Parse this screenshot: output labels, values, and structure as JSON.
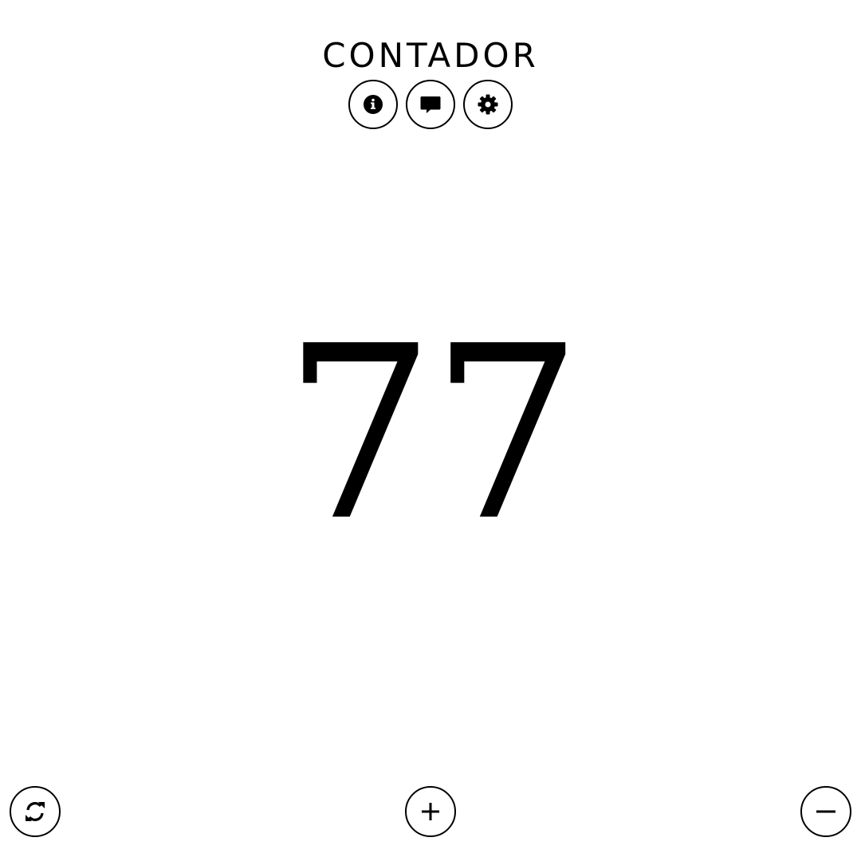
{
  "header": {
    "title": "CONTADOR",
    "icons": [
      {
        "name": "info-icon"
      },
      {
        "name": "comment-icon"
      },
      {
        "name": "gear-icon"
      }
    ]
  },
  "counter": {
    "value": "77"
  },
  "controls": {
    "reset_icon": "refresh-icon",
    "increment_icon": "plus-icon",
    "decrement_icon": "minus-icon"
  },
  "colors": {
    "background": "#ffffff",
    "foreground": "#000000"
  }
}
